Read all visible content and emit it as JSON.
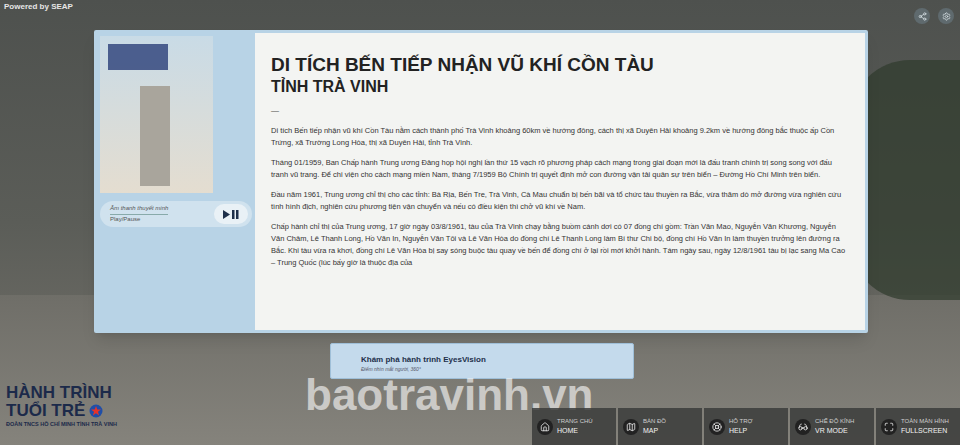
{
  "powered_by": "Powered by SEAP",
  "info_panel": {
    "title": "DI TÍCH BẾN TIẾP NHẬN VŨ KHÍ CỒN TÀU",
    "subtitle": "TỈNH TRÀ VINH",
    "divider": "—",
    "paragraphs": [
      "Di tích Bến tiếp nhận vũ khí Cồn Tàu nằm cách thành phố Trà Vinh khoảng 60km về hướng đông, cách thị xã Duyên Hải khoảng 9.2km về hướng đông bắc thuộc ấp Cồn Trứng, xã Trường Long Hòa, thị xã Duyên Hải, tỉnh Trà Vinh.",
      "Tháng 01/1959, Ban Chấp hành Trung ương Đảng họp hội nghị lần thứ 15 vạch rõ phương pháp cách mạng trong giai đoạn mới là đấu tranh chính trị song song với đấu tranh vũ trang. Để chi viện cho cách mạng miền Nam, tháng 7/1959 Bộ Chính trị quyết định mở con đường vận tải quân sự trên biển – Đường Hồ Chí Minh trên biển.",
      "Đầu năm 1961, Trung ương chỉ thị cho các tỉnh: Bà Rịa, Bến Tre, Trà Vinh, Cà Mau chuẩn bị bến bãi và tổ chức tàu thuyền ra Bắc, vừa thăm dò mở đường vừa nghiên cứu tình hình địch, nghiên cứu phương tiện vận chuyển và nếu có điều kiện thì chở vũ khí về Nam.",
      "Chấp hành chỉ thị của Trung ương, 17 giờ ngày 03/8/1961, tàu của Trà Vinh chạy bằng buồm cánh dơi có 07 đồng chí gồm: Trần Văn Mao, Nguyễn Văn Khương, Nguyễn Văn Châm, Lê Thanh Long, Hồ Văn In, Nguyễn Văn Tôi và Lê Văn Hòa do đồng chí Lê Thanh Long làm Bí thư Chi bộ, đồng chí Hồ Văn In làm thuyền trưởng lên đường ra Bắc. Khi tàu vừa ra khơi, đồng chí Lê Văn Hòa bị say sóng buộc tàu quay về bến để đồng chí ở lại rồi mới khởi hành. Tám ngày sau, ngày 12/8/1961 tàu bị lạc sang Ma Cao – Trung Quốc (lúc bấy giờ là thuộc địa của"
    ],
    "audio": {
      "label": "Âm thanh thuyết minh",
      "button": "Play/Pause"
    }
  },
  "tour_button": {
    "title": "Khám phá hành trình EyesVision",
    "subtitle": "Điểm nhìn mắt người, 360°"
  },
  "watermark": "baotravinh.vn",
  "logo": {
    "line1": "HÀNH TRÌNH",
    "line2": "TUỔI TRẺ",
    "line3": "ĐOÀN TNCS HỒ CHÍ MINH TỈNH TRÀ VINH"
  },
  "toolbar": [
    {
      "label": "TRANG CHỦ",
      "sublabel": "HOME"
    },
    {
      "label": "BẢN ĐỒ",
      "sublabel": "MAP"
    },
    {
      "label": "HỖ TRỢ",
      "sublabel": "HELP"
    },
    {
      "label": "CHẾ ĐỘ KÍNH",
      "sublabel": "VR MODE"
    },
    {
      "label": "TOÀN MÀN HÌNH",
      "sublabel": "FULLSCREEN"
    }
  ]
}
